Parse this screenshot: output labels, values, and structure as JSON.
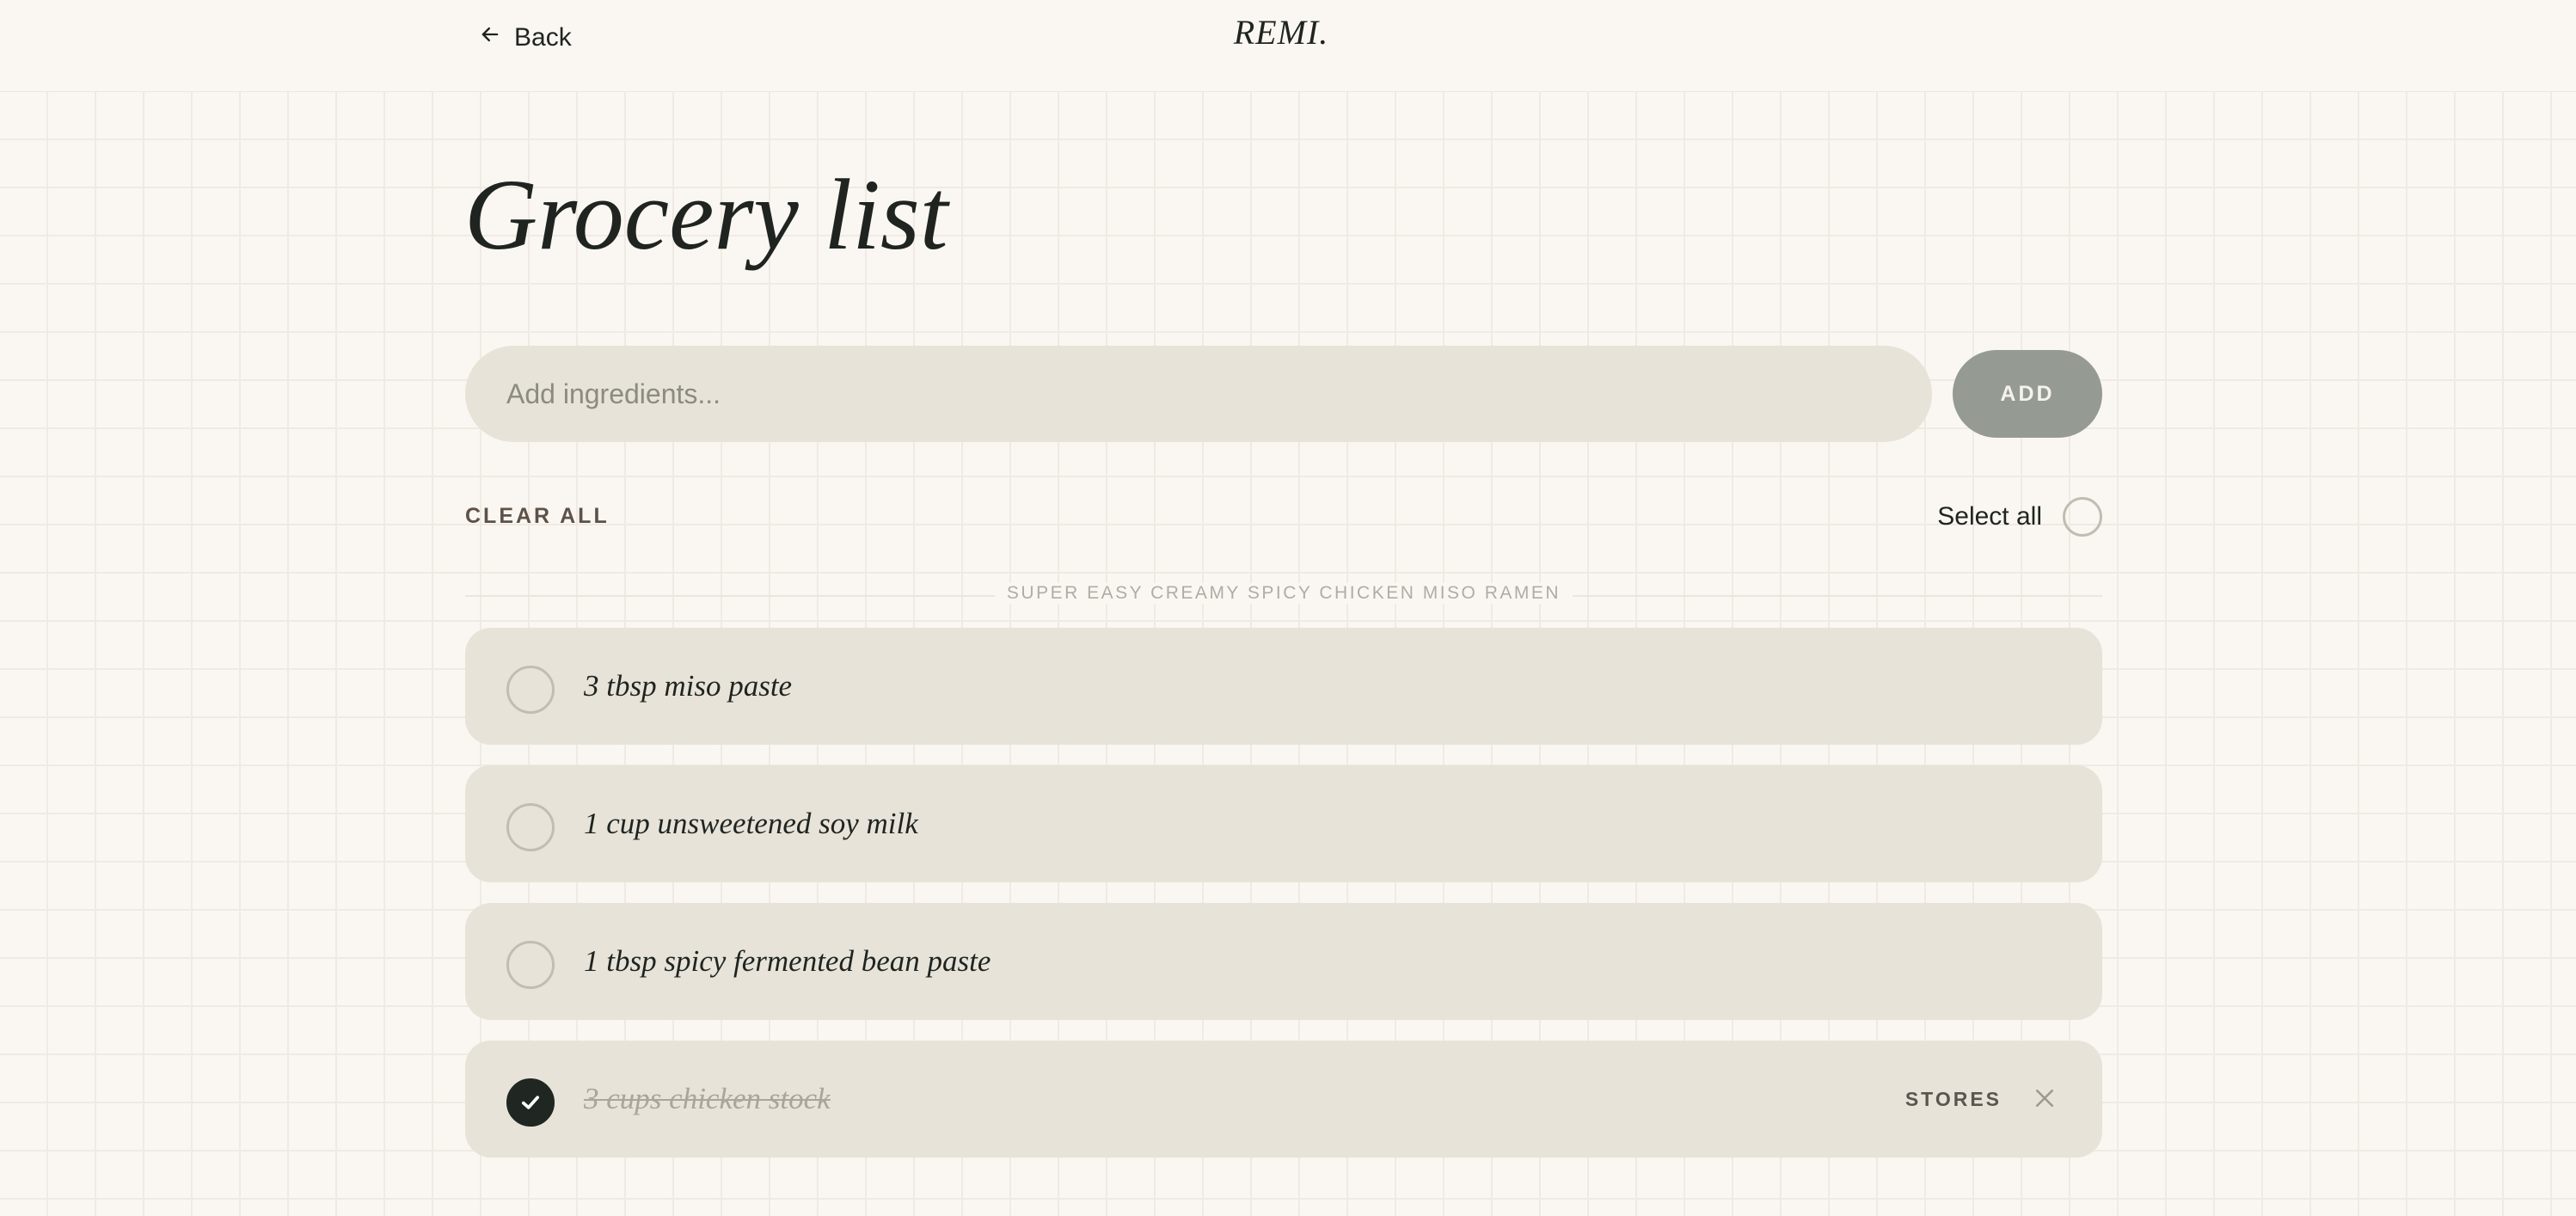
{
  "header": {
    "back_label": "Back",
    "brand": "REMI."
  },
  "page": {
    "title": "Grocery list"
  },
  "add_form": {
    "placeholder": "Add ingredients...",
    "value": "",
    "add_label": "ADD"
  },
  "controls": {
    "clear_all_label": "CLEAR ALL",
    "select_all_label": "Select all",
    "select_all_checked": false
  },
  "section": {
    "recipe_title": "SUPER EASY CREAMY SPICY CHICKEN MISO RAMEN"
  },
  "items": [
    {
      "label": "3 tbsp miso paste",
      "checked": false
    },
    {
      "label": "1 cup unsweetened soy milk",
      "checked": false
    },
    {
      "label": "1 tbsp spicy fermented bean paste",
      "checked": false
    },
    {
      "label": "3 cups chicken stock",
      "checked": true,
      "stores_label": "STORES"
    }
  ],
  "icons": {
    "back": "arrow-left-icon",
    "check": "checkmark-icon",
    "remove": "close-icon"
  },
  "colors": {
    "background": "#faf7f2",
    "card": "#e7e3d8",
    "add_button": "#959a92",
    "checked_circle": "#202622",
    "text": "#1f2420"
  }
}
